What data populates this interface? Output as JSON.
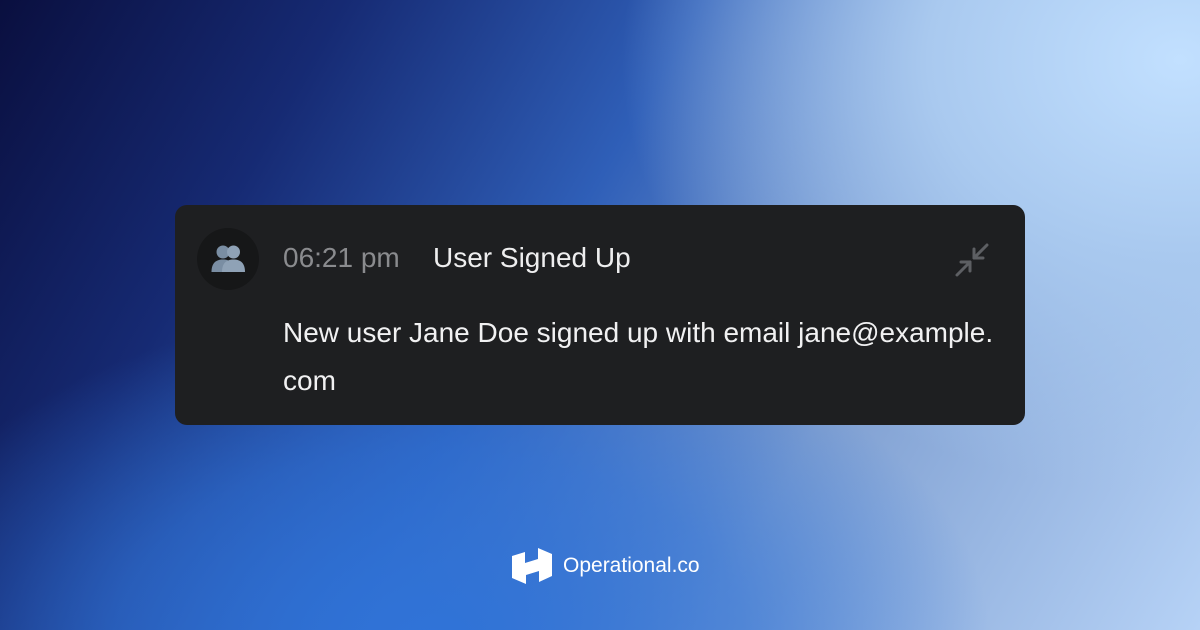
{
  "notification": {
    "avatar_icon": "users-icon",
    "time": "06:21 pm",
    "title": "User Signed Up",
    "message": "New user Jane Doe signed up with email jane@example.com",
    "collapse_icon": "collapse-icon"
  },
  "brand": {
    "logo_icon": "operational-logo-icon",
    "name": "Operational.co"
  },
  "colors": {
    "card_background": "#1e1f21",
    "avatar_background": "#161718",
    "time_text": "#8a8b8e",
    "title_text": "#eeeeef",
    "message_text": "#f1f1f2",
    "avatar_figures": "#7a8ea3"
  }
}
